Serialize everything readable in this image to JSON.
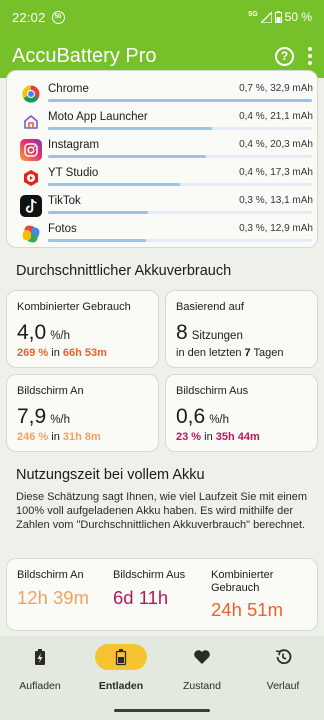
{
  "status": {
    "time": "22:02",
    "sim_badge": "50",
    "network": "5G",
    "battery": "50 %"
  },
  "appbar": {
    "title": "AccuBattery Pro",
    "help_icon": "help-circle-icon",
    "more_icon": "more-vert-icon"
  },
  "apps": [
    {
      "name": "Chrome",
      "stats": "0,7 %, 32,9 mAh",
      "icon": "chrome-icon",
      "bar_fraction": 1.0
    },
    {
      "name": "Moto App Launcher",
      "stats": "0,4 %, 21,1 mAh",
      "icon": "home-launcher-icon",
      "bar_fraction": 0.62
    },
    {
      "name": "Instagram",
      "stats": "0,4 %, 20,3 mAh",
      "icon": "instagram-icon",
      "bar_fraction": 0.6
    },
    {
      "name": "YT Studio",
      "stats": "0,4 %, 17,3 mAh",
      "icon": "yt-studio-icon",
      "bar_fraction": 0.5
    },
    {
      "name": "TikTok",
      "stats": "0,3 %, 13,1 mAh",
      "icon": "tiktok-icon",
      "bar_fraction": 0.38
    },
    {
      "name": "Fotos",
      "stats": "0,3 %, 12,9 mAh",
      "icon": "photos-icon",
      "bar_fraction": 0.37
    }
  ],
  "avg": {
    "title": "Durchschnittlicher Akkuverbrauch",
    "combined": {
      "label": "Kombinierter Gebrauch",
      "value": "4,0",
      "unit": "%/h",
      "pct": "269 %",
      "in": "in",
      "dur": "66h 53m"
    },
    "based": {
      "label": "Basierend auf",
      "value": "8",
      "unit": "Sitzungen",
      "sub_pre": "in den letzten",
      "days": "7",
      "sub_post": "Tagen"
    },
    "screen_on": {
      "label": "Bildschirm An",
      "value": "7,9",
      "unit": "%/h",
      "pct": "246 %",
      "in": "in",
      "dur": "31h 8m"
    },
    "screen_off": {
      "label": "Bildschirm Aus",
      "value": "0,6",
      "unit": "%/h",
      "pct": "23 %",
      "in": "in",
      "dur": "35h 44m"
    }
  },
  "full": {
    "title": "Nutzungszeit bei vollem Akku",
    "desc": "Diese Schätzung sagt Ihnen, wie viel Laufzeit Sie mit einem 100% voll aufgeladenen Akku haben. Es wird mithilfe der Zahlen vom \"Durchschnittlichen Akkuverbrauch\" berechnet.",
    "screen_on": {
      "label": "Bildschirm An",
      "value": "12h 39m"
    },
    "screen_off": {
      "label": "Bildschirm Aus",
      "value": "6d 11h"
    },
    "combined": {
      "label": "Kombinierter Gebrauch",
      "value": "24h 51m"
    }
  },
  "nav": [
    {
      "label": "Aufladen",
      "icon": "battery-charging-icon",
      "active": false
    },
    {
      "label": "Entladen",
      "icon": "battery-discharge-icon",
      "active": true
    },
    {
      "label": "Zustand",
      "icon": "heart-icon",
      "active": false
    },
    {
      "label": "Verlauf",
      "icon": "history-icon",
      "active": false
    }
  ],
  "colors": {
    "accent": "#76c12a",
    "orange": "#f0602a",
    "peach": "#f2a25d",
    "berry": "#b5195c",
    "nav_active": "#f6c431"
  }
}
